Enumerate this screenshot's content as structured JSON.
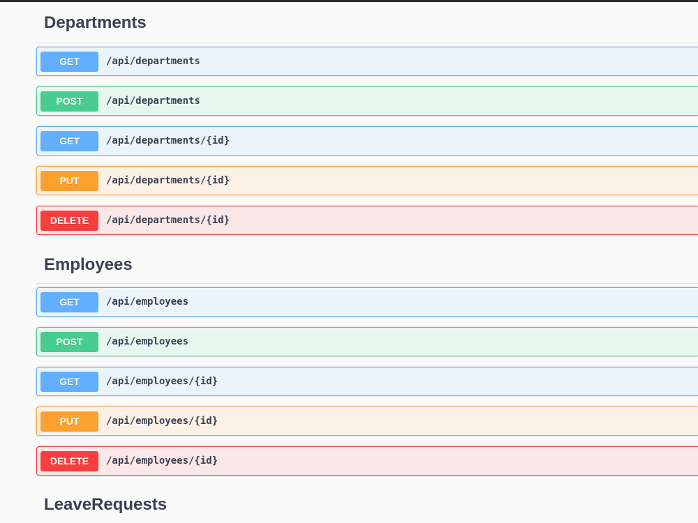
{
  "sections": [
    {
      "title": "Departments",
      "operations": [
        {
          "method": "GET",
          "path": "/api/departments"
        },
        {
          "method": "POST",
          "path": "/api/departments"
        },
        {
          "method": "GET",
          "path": "/api/departments/{id}"
        },
        {
          "method": "PUT",
          "path": "/api/departments/{id}"
        },
        {
          "method": "DELETE",
          "path": "/api/departments/{id}"
        }
      ]
    },
    {
      "title": "Employees",
      "operations": [
        {
          "method": "GET",
          "path": "/api/employees"
        },
        {
          "method": "POST",
          "path": "/api/employees"
        },
        {
          "method": "GET",
          "path": "/api/employees/{id}"
        },
        {
          "method": "PUT",
          "path": "/api/employees/{id}"
        },
        {
          "method": "DELETE",
          "path": "/api/employees/{id}"
        }
      ]
    },
    {
      "title": "LeaveRequests",
      "operations": []
    }
  ],
  "colors": {
    "get": "#61affe",
    "post": "#49cc90",
    "put": "#fca130",
    "delete": "#f93e3e",
    "text": "#3b4151"
  }
}
